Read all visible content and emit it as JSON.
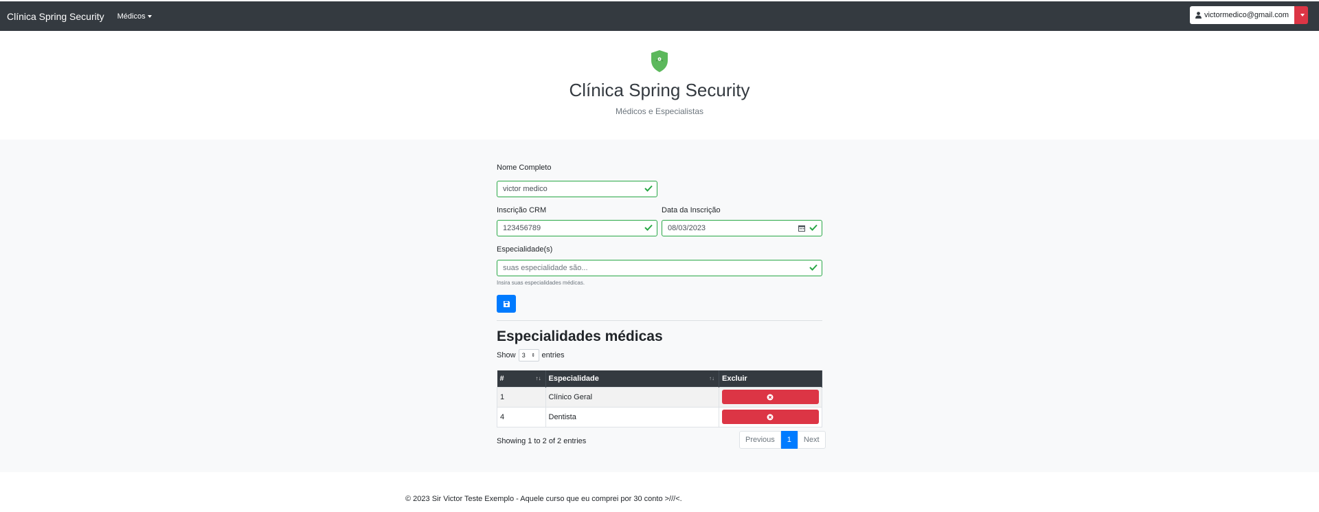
{
  "navbar": {
    "brand": "Clínica Spring Security",
    "menu_label": "Médicos",
    "user_email": "victormedico@gmail.com"
  },
  "header": {
    "title": "Clínica Spring Security",
    "subtitle": "Médicos e Especialistas"
  },
  "form": {
    "nome_label": "Nome Completo",
    "nome_value": "victor medico",
    "crm_label": "Inscrição CRM",
    "crm_value": "123456789",
    "data_label": "Data da Inscrição",
    "data_value": "08/03/2023",
    "esp_label": "Especialidade(s)",
    "esp_placeholder": "suas especialidade são...",
    "esp_help": "Insira suas especialidades médicas."
  },
  "table_section": {
    "title": "Especialidades médicas",
    "show_label": "Show",
    "show_value": "3",
    "entries_label": "entries",
    "columns": [
      "#",
      "Especialidade",
      "Excluir"
    ],
    "rows": [
      {
        "id": "1",
        "especialidade": "Clínico Geral"
      },
      {
        "id": "4",
        "especialidade": "Dentista"
      }
    ],
    "info": "Showing 1 to 2 of 2 entries",
    "pagination": {
      "previous": "Previous",
      "page": "1",
      "next": "Next"
    }
  },
  "footer": {
    "text": "© 2023 Sir Victor Teste Exemplo - Aquele curso que eu comprei por 30 conto >///<."
  },
  "colors": {
    "navbar": "#343a40",
    "primary": "#007bff",
    "danger": "#dc3545",
    "success": "#28a745",
    "logo": "#5cb85c"
  }
}
